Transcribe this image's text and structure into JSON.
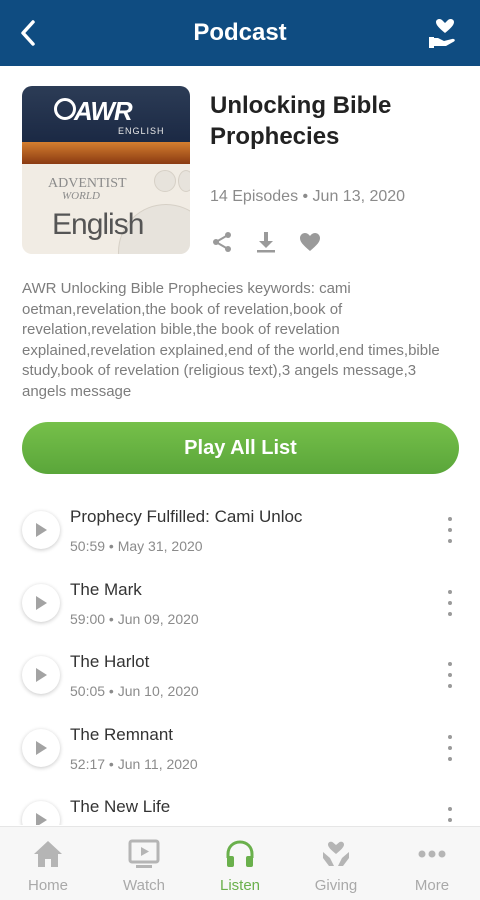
{
  "header": {
    "title": "Podcast"
  },
  "podcast": {
    "title": "Unlocking Bible Prophecies",
    "meta": "14 Episodes • Jun 13, 2020",
    "description": "AWR Unlocking Bible Prophecies keywords: cami oetman,revelation,the book of revelation,book of revelation,revelation bible,the book of revelation explained,revelation explained,end of the world,end times,bible study,book of revelation (religious text),3 angels message,3 angels message",
    "cover": {
      "brand": "AWR",
      "brand_sub": "ENGLISH",
      "line1": "ADVENTIST",
      "line2": "WORLD",
      "lang": "English"
    }
  },
  "play_all_label": "Play All List",
  "episodes": [
    {
      "title": "Prophecy Fulfilled: Cami Unloc",
      "meta": "50:59 • May 31, 2020"
    },
    {
      "title": "The Mark",
      "meta": "59:00 • Jun 09, 2020"
    },
    {
      "title": "The Harlot",
      "meta": "50:05 • Jun 10, 2020"
    },
    {
      "title": "The Remnant",
      "meta": "52:17 • Jun 11, 2020"
    },
    {
      "title": "The New Life",
      "meta": ""
    }
  ],
  "tabs": [
    {
      "label": "Home",
      "icon": "home-icon"
    },
    {
      "label": "Watch",
      "icon": "watch-icon"
    },
    {
      "label": "Listen",
      "icon": "headphones-icon"
    },
    {
      "label": "Giving",
      "icon": "giving-icon"
    },
    {
      "label": "More",
      "icon": "more-icon"
    }
  ],
  "colors": {
    "header": "#0f4c81",
    "accent": "#6ab04c",
    "muted": "#8b8b8b"
  }
}
